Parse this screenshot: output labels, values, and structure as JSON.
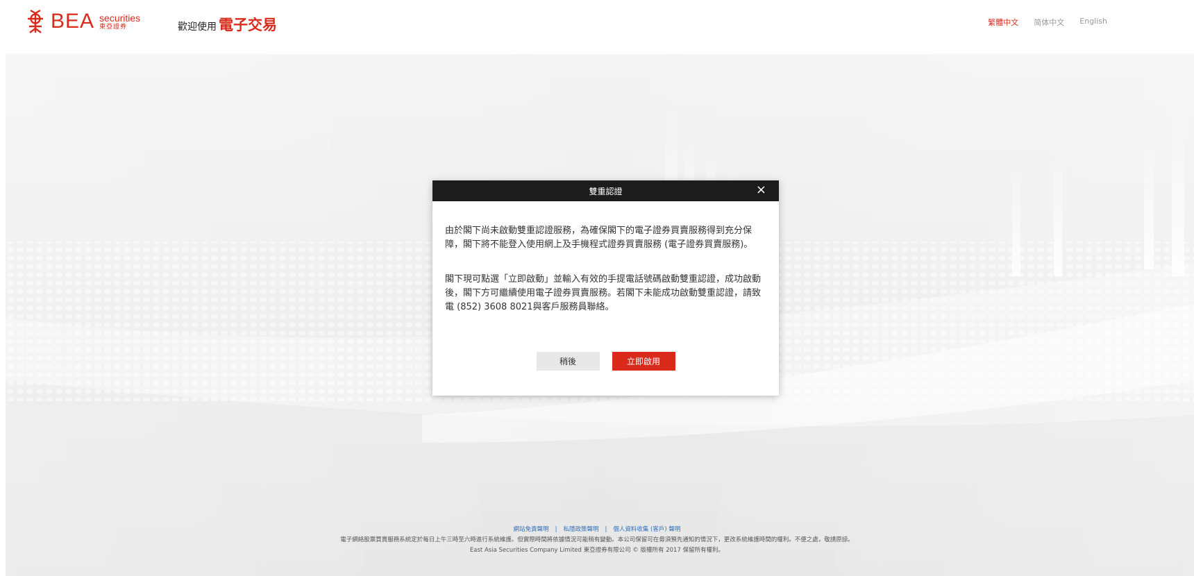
{
  "header": {
    "logo": {
      "brand": "BEA",
      "sub_en": "securities",
      "sub_zh": "東亞證券"
    },
    "welcome_prefix": "歡迎使用",
    "welcome_highlight": "電子交易",
    "languages": [
      {
        "label": "繁體中文",
        "active": true
      },
      {
        "label": "简体中文",
        "active": false
      },
      {
        "label": "English",
        "active": false
      }
    ]
  },
  "modal": {
    "title": "雙重認證",
    "close_icon": "close-icon",
    "paragraphs": [
      "由於閣下尚未啟動雙重認證服務，為確保閣下的電子證券買賣服務得到充分保障，閣下將不能登入使用網上及手機程式證券買賣服務 (電子證券買賣服務)。",
      "閣下現可點選「立即啟動」並輸入有效的手提電話號碼啟動雙重認證，成功啟動後，閣下方可繼續使用電子證券買賣服務。若閣下未能成功啟動雙重認證，請致電 (852) 3608 8021與客戶服務員聯絡。"
    ],
    "later_label": "稍後",
    "activate_label": "立即啟用"
  },
  "footer": {
    "links": [
      "網站免責聲明",
      "私隱政策聲明",
      "個人資料收集 (客戶) 聲明"
    ],
    "separator": "|",
    "notice": "電子網絡股票買賣服務系統定於每日上午三時至六時進行系統維護。但實際時間將依據情況可能稍有變動。本公司保留可在毋須預先通知的情況下，更改系統維護時間的權利。不便之處，敬請原諒。",
    "copyright": "East Asia Securities Company Limited 東亞證券有限公司 © 版權所有 2017 保留所有權利。"
  },
  "colors": {
    "brand_red": "#d92a1c",
    "modal_header": "#1c1c1c",
    "link_blue": "#2f6fb7"
  }
}
